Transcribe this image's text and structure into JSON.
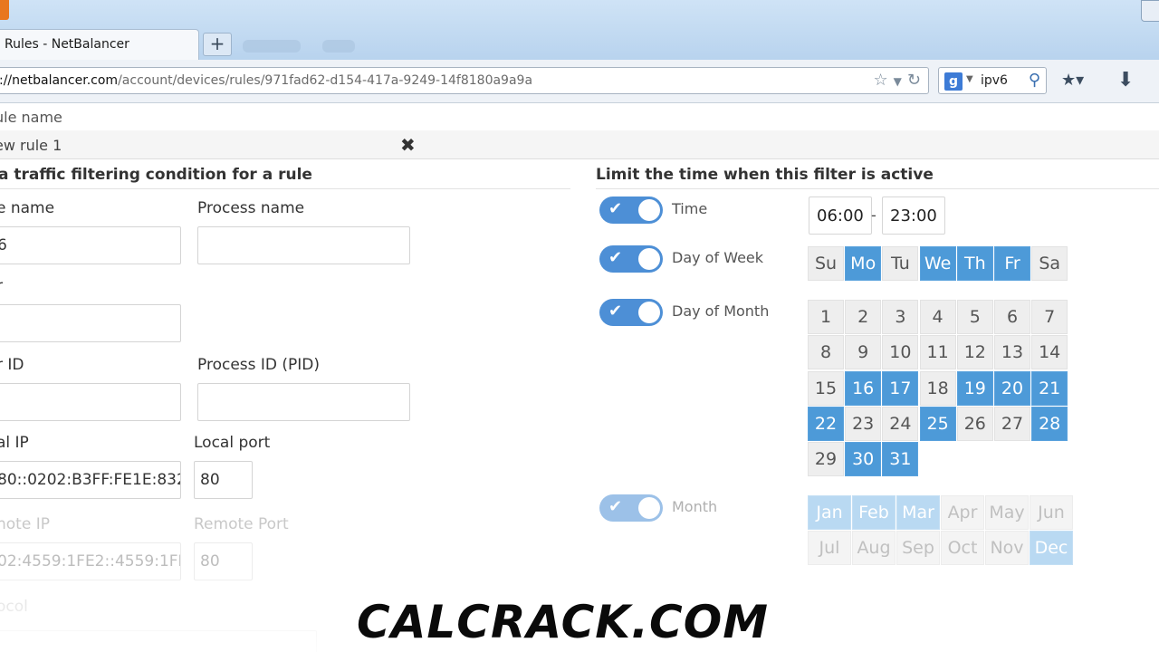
{
  "browser": {
    "tab_title": "Rules - NetBalancer",
    "new_tab_label": "+",
    "url_domain": "://netbalancer.com",
    "url_path": "/account/devices/rules/971fad62-d154-417a-9249-14f8180a9a9a",
    "search_engine_glyph": "g",
    "search_text": "ipv6"
  },
  "rule": {
    "name_label": "ule name",
    "name_value": "ew rule 1"
  },
  "filter": {
    "heading": "a traffic filtering condition for a rule",
    "fields": {
      "file_name_label": "e name",
      "file_name_value": "6",
      "process_name_label": "Process name",
      "process_name_value": "",
      "user_label": "r",
      "user_value": "",
      "user_id_label": "r ID",
      "user_id_value": "",
      "pid_label": "Process ID (PID)",
      "pid_value": "",
      "local_ip_label": "al IP",
      "local_ip_value": "80::0202:B3FF:FE1E:832",
      "local_port_label": "Local port",
      "local_port_value": "80",
      "remote_ip_label": "note IP",
      "remote_ip_value": "02:4559:1FE2::4559:1FE",
      "remote_port_label": "Remote Port",
      "remote_port_value": "80",
      "protocol_label": "ocol"
    }
  },
  "time_limit": {
    "heading": "Limit the time when this filter is active",
    "toggles": {
      "time": "Time",
      "day_of_week": "Day of Week",
      "day_of_month": "Day of Month",
      "month": "Month"
    },
    "time_from": "06:00",
    "time_sep": "-",
    "time_to": "23:00",
    "weekdays": [
      {
        "label": "Su",
        "selected": false
      },
      {
        "label": "Mo",
        "selected": true
      },
      {
        "label": "Tu",
        "selected": false
      },
      {
        "label": "We",
        "selected": true
      },
      {
        "label": "Th",
        "selected": true
      },
      {
        "label": "Fr",
        "selected": true
      },
      {
        "label": "Sa",
        "selected": false
      }
    ],
    "month_days": [
      {
        "label": "1",
        "selected": false
      },
      {
        "label": "2",
        "selected": false
      },
      {
        "label": "3",
        "selected": false
      },
      {
        "label": "4",
        "selected": false
      },
      {
        "label": "5",
        "selected": false
      },
      {
        "label": "6",
        "selected": false
      },
      {
        "label": "7",
        "selected": false
      },
      {
        "label": "8",
        "selected": false
      },
      {
        "label": "9",
        "selected": false
      },
      {
        "label": "10",
        "selected": false
      },
      {
        "label": "11",
        "selected": false
      },
      {
        "label": "12",
        "selected": false
      },
      {
        "label": "13",
        "selected": false
      },
      {
        "label": "14",
        "selected": false
      },
      {
        "label": "15",
        "selected": false
      },
      {
        "label": "16",
        "selected": true
      },
      {
        "label": "17",
        "selected": true
      },
      {
        "label": "18",
        "selected": false
      },
      {
        "label": "19",
        "selected": true
      },
      {
        "label": "20",
        "selected": true
      },
      {
        "label": "21",
        "selected": true
      },
      {
        "label": "22",
        "selected": true
      },
      {
        "label": "23",
        "selected": false
      },
      {
        "label": "24",
        "selected": false
      },
      {
        "label": "25",
        "selected": true
      },
      {
        "label": "26",
        "selected": false
      },
      {
        "label": "27",
        "selected": false
      },
      {
        "label": "28",
        "selected": true
      },
      {
        "label": "29",
        "selected": false
      },
      {
        "label": "30",
        "selected": true
      },
      {
        "label": "31",
        "selected": true
      }
    ],
    "months": [
      {
        "label": "Jan",
        "selected": true
      },
      {
        "label": "Feb",
        "selected": true
      },
      {
        "label": "Mar",
        "selected": true
      },
      {
        "label": "Apr",
        "selected": false
      },
      {
        "label": "May",
        "selected": false
      },
      {
        "label": "Jun",
        "selected": false
      },
      {
        "label": "Jul",
        "selected": false
      },
      {
        "label": "Aug",
        "selected": false
      },
      {
        "label": "Sep",
        "selected": false
      },
      {
        "label": "Oct",
        "selected": false
      },
      {
        "label": "Nov",
        "selected": false
      },
      {
        "label": "Dec",
        "selected": true
      }
    ]
  },
  "watermark": "CALCRACK.COM",
  "colors": {
    "accent": "#4d9ad8",
    "toggle": "#4d8fd6"
  }
}
